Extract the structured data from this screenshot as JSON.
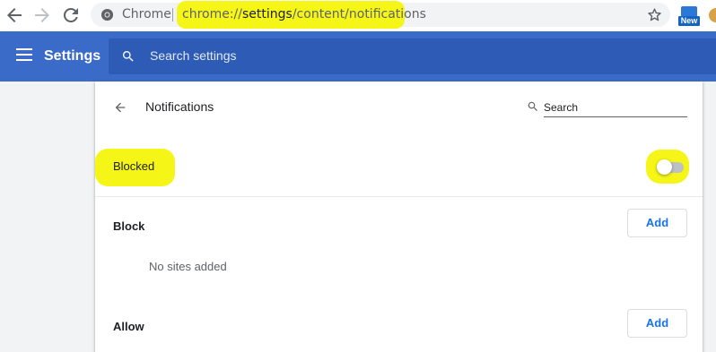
{
  "browser": {
    "site_chip": "Chrome",
    "url": {
      "prefix": "chrome://",
      "host": "settings",
      "path": "/content/notifications"
    },
    "extension_badge": "New"
  },
  "header": {
    "title": "Settings",
    "search_placeholder": "Search settings",
    "color": "#3b6bc9"
  },
  "page": {
    "title": "Notifications",
    "search_placeholder": "Search",
    "toggle": {
      "label": "Blocked",
      "state": "off"
    },
    "sections": [
      {
        "label": "Block",
        "button": "Add",
        "empty_text": "No sites added"
      },
      {
        "label": "Allow",
        "button": "Add"
      }
    ]
  },
  "annotations": {
    "highlight_color": "#f5f517"
  }
}
